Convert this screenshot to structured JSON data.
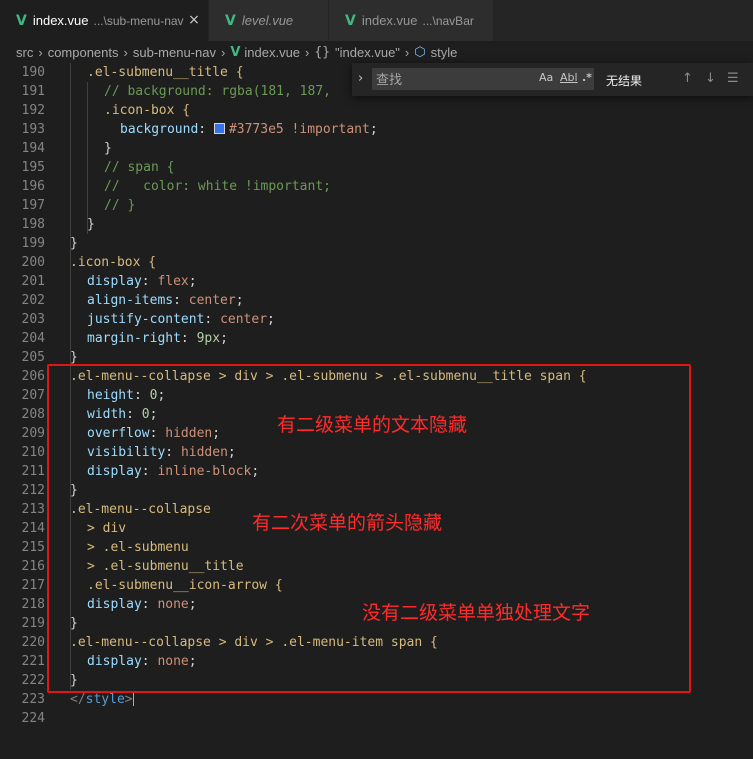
{
  "tabs": [
    {
      "name": "index.vue",
      "desc": "...\\sub-menu-nav",
      "active": true,
      "close": "×"
    },
    {
      "name": "level.vue",
      "desc": "",
      "italic": true
    },
    {
      "name": "index.vue",
      "desc": "...\\navBar"
    }
  ],
  "breadcrumb": {
    "items": [
      "src",
      "components",
      "sub-menu-nav",
      "index.vue",
      "\"index.vue\"",
      "style"
    ],
    "brace": "{}"
  },
  "find_widget": {
    "placeholder": "查找",
    "match_case": "Aa",
    "whole_word": "Abl",
    "regex": ".*",
    "result": "无结果"
  },
  "code_lines": [
    {
      "n": "190"
    },
    {
      "n": "191"
    },
    {
      "n": "192"
    },
    {
      "n": "193"
    },
    {
      "n": "194"
    },
    {
      "n": "195"
    },
    {
      "n": "196"
    },
    {
      "n": "197"
    },
    {
      "n": "198"
    },
    {
      "n": "199"
    },
    {
      "n": "200"
    },
    {
      "n": "201"
    },
    {
      "n": "202"
    },
    {
      "n": "203"
    },
    {
      "n": "204"
    },
    {
      "n": "205"
    },
    {
      "n": "206"
    },
    {
      "n": "207"
    },
    {
      "n": "208"
    },
    {
      "n": "209"
    },
    {
      "n": "210"
    },
    {
      "n": "211"
    },
    {
      "n": "212"
    },
    {
      "n": "213"
    },
    {
      "n": "214"
    },
    {
      "n": "215"
    },
    {
      "n": "216"
    },
    {
      "n": "217"
    },
    {
      "n": "218"
    },
    {
      "n": "219"
    },
    {
      "n": "220"
    },
    {
      "n": "221"
    },
    {
      "n": "222"
    },
    {
      "n": "223"
    },
    {
      "n": "224"
    }
  ],
  "code": {
    "l190": ".el-submenu__title {",
    "l191": "// background: rgba(181, 187,",
    "l192": ".icon-box {",
    "l193_prop": "background",
    "l193_val": "#3773e5 !important",
    "l194": "}",
    "l195": "// span {",
    "l196": "//   color: white !important;",
    "l197": "// }",
    "l198": "}",
    "l199": "}",
    "l200": ".icon-box {",
    "l201_prop": "display",
    "l201_val": "flex",
    "l202_prop": "align-items",
    "l202_val": "center",
    "l203_prop": "justify-content",
    "l203_val": "center",
    "l204_prop": "margin-right",
    "l204_val": "9px",
    "l205": "}",
    "l206": ".el-menu--collapse > div > .el-submenu > .el-submenu__title span {",
    "l207_prop": "height",
    "l207_val": "0",
    "l208_prop": "width",
    "l208_val": "0",
    "l209_prop": "overflow",
    "l209_val": "hidden",
    "l210_prop": "visibility",
    "l210_val": "hidden",
    "l211_prop": "display",
    "l211_val": "inline-block",
    "l212": "}",
    "l213": ".el-menu--collapse",
    "l214": "> div",
    "l215": "> .el-submenu",
    "l216": "> .el-submenu__title",
    "l217": ".el-submenu__icon-arrow {",
    "l218_prop": "display",
    "l218_val": "none",
    "l219": "}",
    "l220": ".el-menu--collapse > div > .el-menu-item span {",
    "l221_prop": "display",
    "l221_val": "none",
    "l222": "}",
    "l223_tag": "style"
  },
  "annotations": {
    "note1": "有二级菜单的文本隐藏",
    "note2": "有二次菜单的箭头隐藏",
    "note3": "没有二级菜单单独处理文字"
  },
  "colors": {
    "swatch": "#3773e5",
    "highlight_box": "#e01616",
    "annotation_text": "#ff2b2b",
    "vue_icon": "#41b883"
  }
}
